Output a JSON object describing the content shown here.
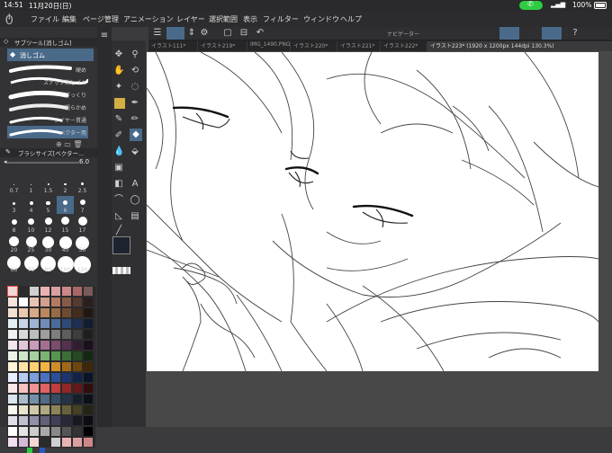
{
  "status": {
    "time": "14:51",
    "date": "11月20日(日)",
    "battery": "100%"
  },
  "menu": [
    "ファイル",
    "編集",
    "ページ管理",
    "アニメーション",
    "レイヤー",
    "選択範囲",
    "表示",
    "フィルター",
    "ウィンドウ",
    "ヘルプ"
  ],
  "subtool": {
    "title": "サブツール[消しゴム]",
    "active_tool": "消しゴム",
    "items": [
      "硬め",
      "スナップ消しゴム",
      "ざっくり",
      "粗らかめ",
      "レイヤー貫通",
      "ベクター用"
    ]
  },
  "brush": {
    "title": "ブラシサイズ[ベクター...",
    "value": "6.0",
    "sizes": [
      "0.7",
      "1",
      "1.5",
      "2",
      "2.5",
      "3",
      "4",
      "5",
      "6",
      "7",
      "8",
      "10",
      "12",
      "15",
      "17",
      "20",
      "25",
      "30",
      "40",
      "50",
      "60",
      "70",
      "80",
      "100",
      "120"
    ]
  },
  "navigator_label": "ナビゲーター",
  "tabs": [
    "イラスト111*",
    "イラスト219*",
    "IMG_1490.PNG",
    "イラスト220*",
    "イラスト221*",
    "イラスト222*",
    "イラスト223* (1920 x 1200px 144dpi 130.3%)"
  ],
  "colors": {
    "main": "#1d2430",
    "sub": "#2a3a4a",
    "accent": "#2ecc40"
  }
}
